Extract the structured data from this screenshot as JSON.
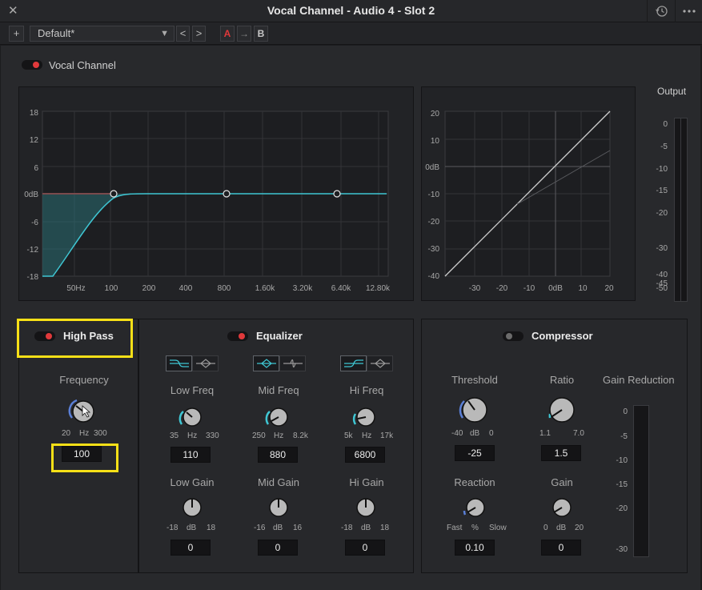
{
  "window": {
    "title": "Vocal Channel - Audio 4 -  Slot 2"
  },
  "toolbar": {
    "add_label": "+",
    "preset": "Default*",
    "prev": "<",
    "next": ">",
    "a_label": "A",
    "copy_label": "→",
    "b_label": "B"
  },
  "channel": {
    "label": "Vocal Channel",
    "enabled": true
  },
  "eq_graph": {
    "y_ticks": [
      "18",
      "12",
      "6",
      "0dB",
      "-6",
      "-12",
      "-18"
    ],
    "x_ticks": [
      "50Hz",
      "100",
      "200",
      "400",
      "800",
      "1.60k",
      "3.20k",
      "6.40k",
      "12.80k"
    ],
    "curve_color": "#3fc6d3"
  },
  "comp_graph": {
    "y_ticks": [
      "20",
      "10",
      "0dB",
      "-10",
      "-20",
      "-30",
      "-40"
    ],
    "x_ticks": [
      "-30",
      "-20",
      "-10",
      "0dB",
      "10",
      "20"
    ]
  },
  "output": {
    "label": "Output",
    "ticks": [
      "0",
      "-5",
      "-10",
      "-15",
      "-20",
      "-30",
      "-40",
      "-45",
      "-50"
    ]
  },
  "high_pass": {
    "title": "High Pass",
    "enabled": true,
    "frequency": {
      "label": "Frequency",
      "min": "20",
      "unit": "Hz",
      "max": "300",
      "value": "100"
    }
  },
  "equalizer": {
    "title": "Equalizer",
    "enabled": true,
    "low_freq": {
      "label": "Low Freq",
      "min": "35",
      "unit": "Hz",
      "max": "330",
      "value": "110"
    },
    "mid_freq": {
      "label": "Mid Freq",
      "min": "250",
      "unit": "Hz",
      "max": "8.2k",
      "value": "880"
    },
    "hi_freq": {
      "label": "Hi Freq",
      "min": "5k",
      "unit": "Hz",
      "max": "17k",
      "value": "6800"
    },
    "low_gain": {
      "label": "Low Gain",
      "min": "-18",
      "unit": "dB",
      "max": "18",
      "value": "0"
    },
    "mid_gain": {
      "label": "Mid Gain",
      "min": "-16",
      "unit": "dB",
      "max": "16",
      "value": "0"
    },
    "hi_gain": {
      "label": "Hi Gain",
      "min": "-18",
      "unit": "dB",
      "max": "18",
      "value": "0"
    }
  },
  "compressor": {
    "title": "Compressor",
    "enabled": false,
    "threshold": {
      "label": "Threshold",
      "min": "-40",
      "unit": "dB",
      "max": "0",
      "value": "-25"
    },
    "ratio": {
      "label": "Ratio",
      "min": "1.1",
      "unit": "",
      "max": "7.0",
      "value": "1.5"
    },
    "reaction": {
      "label": "Reaction",
      "min": "Fast",
      "unit": "%",
      "max": "Slow",
      "value": "0.10"
    },
    "gain": {
      "label": "Gain",
      "min": "0",
      "unit": "dB",
      "max": "20",
      "value": "0"
    },
    "gain_reduction": {
      "label": "Gain Reduction",
      "ticks": [
        "0",
        "-5",
        "-10",
        "-15",
        "-20",
        "-30"
      ]
    }
  },
  "colors": {
    "accent": "#3fc6d3",
    "on": "#e0393b",
    "highlight": "#f7e017",
    "knob_arc": "#5a7fd6"
  }
}
